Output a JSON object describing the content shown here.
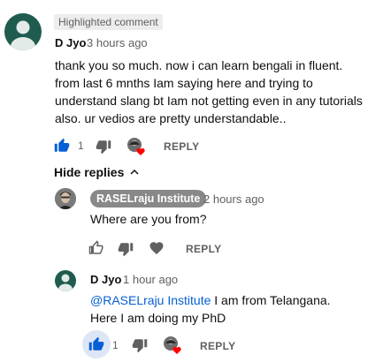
{
  "highlighted_label": "Highlighted comment",
  "main_comment": {
    "author": "D Jyo",
    "time": "3 hours ago",
    "text": "thank you so much.  now i can learn bengali in fluent. from last 6 mnths Iam saying here and trying to understand slang bt Iam not getting even in any tutorials also. ur vedios are pretty understandable..",
    "like_count": "1",
    "reply_label": "REPLY"
  },
  "hide_replies_label": "Hide replies",
  "replies": [
    {
      "author": "RASELraju Institute",
      "time": "2 hours ago",
      "text": "Where are you from?",
      "reply_label": "REPLY"
    },
    {
      "author": "D Jyo",
      "time": "1 hour ago",
      "mention": "@RASELraju Institute",
      "text": " I am from Telangana. Here I am doing my PhD",
      "like_count": "1",
      "reply_label": "REPLY"
    }
  ],
  "colors": {
    "avatar": "#1f5c4f",
    "liked": "#065fd4",
    "heart": "#ff0000",
    "owner_badge": "#888888"
  }
}
